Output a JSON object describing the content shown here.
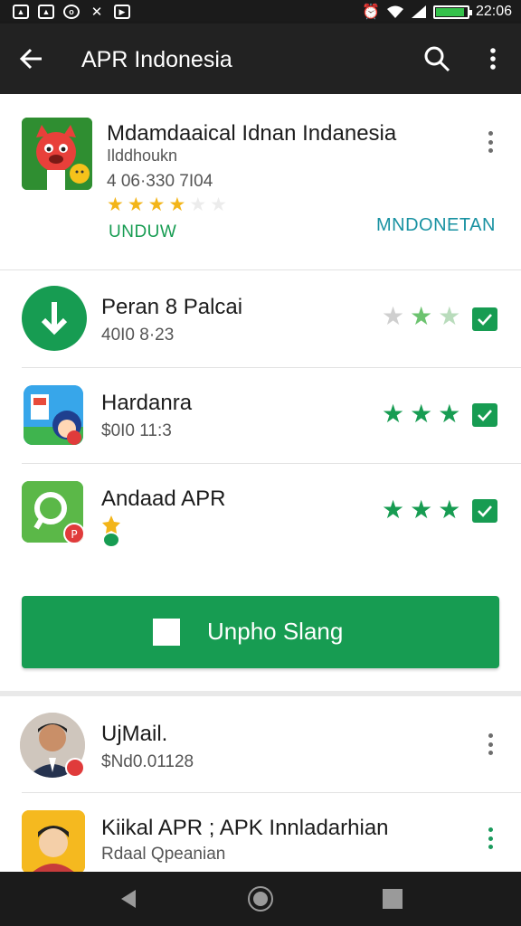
{
  "status_bar": {
    "time": "22:06"
  },
  "app_bar": {
    "title": "APR Indonesia"
  },
  "featured": {
    "title": "Mdamdaaical Idnan Indanesia",
    "developer": "Ilddhoukn",
    "meta": "4 06·330 7I04",
    "rating": 3.5,
    "install_label": "UNDUW",
    "right_label": "MNDONETAN"
  },
  "apps": [
    {
      "title": "Peran 8 Palcai",
      "sub": "40I0 8·23"
    },
    {
      "title": "Hardanra",
      "sub": "$0I0 11:3"
    },
    {
      "title": "Andaad APR",
      "sub": ""
    }
  ],
  "cta": {
    "label": "Unpho Slang"
  },
  "list": [
    {
      "title": "UjMail.",
      "sub": "$Nd0.01128"
    },
    {
      "title": "Kiikal APR ; APK Innladarhian",
      "sub": "Rdaal Qpeanian"
    }
  ],
  "colors": {
    "accent_green": "#179c52",
    "star_gold": "#f3b519",
    "teal": "#1992a2",
    "bar_dark": "#222222"
  },
  "icons": [
    "back-arrow-icon",
    "search-icon",
    "more-vert-icon",
    "download-icon",
    "check-icon",
    "star-icon"
  ]
}
